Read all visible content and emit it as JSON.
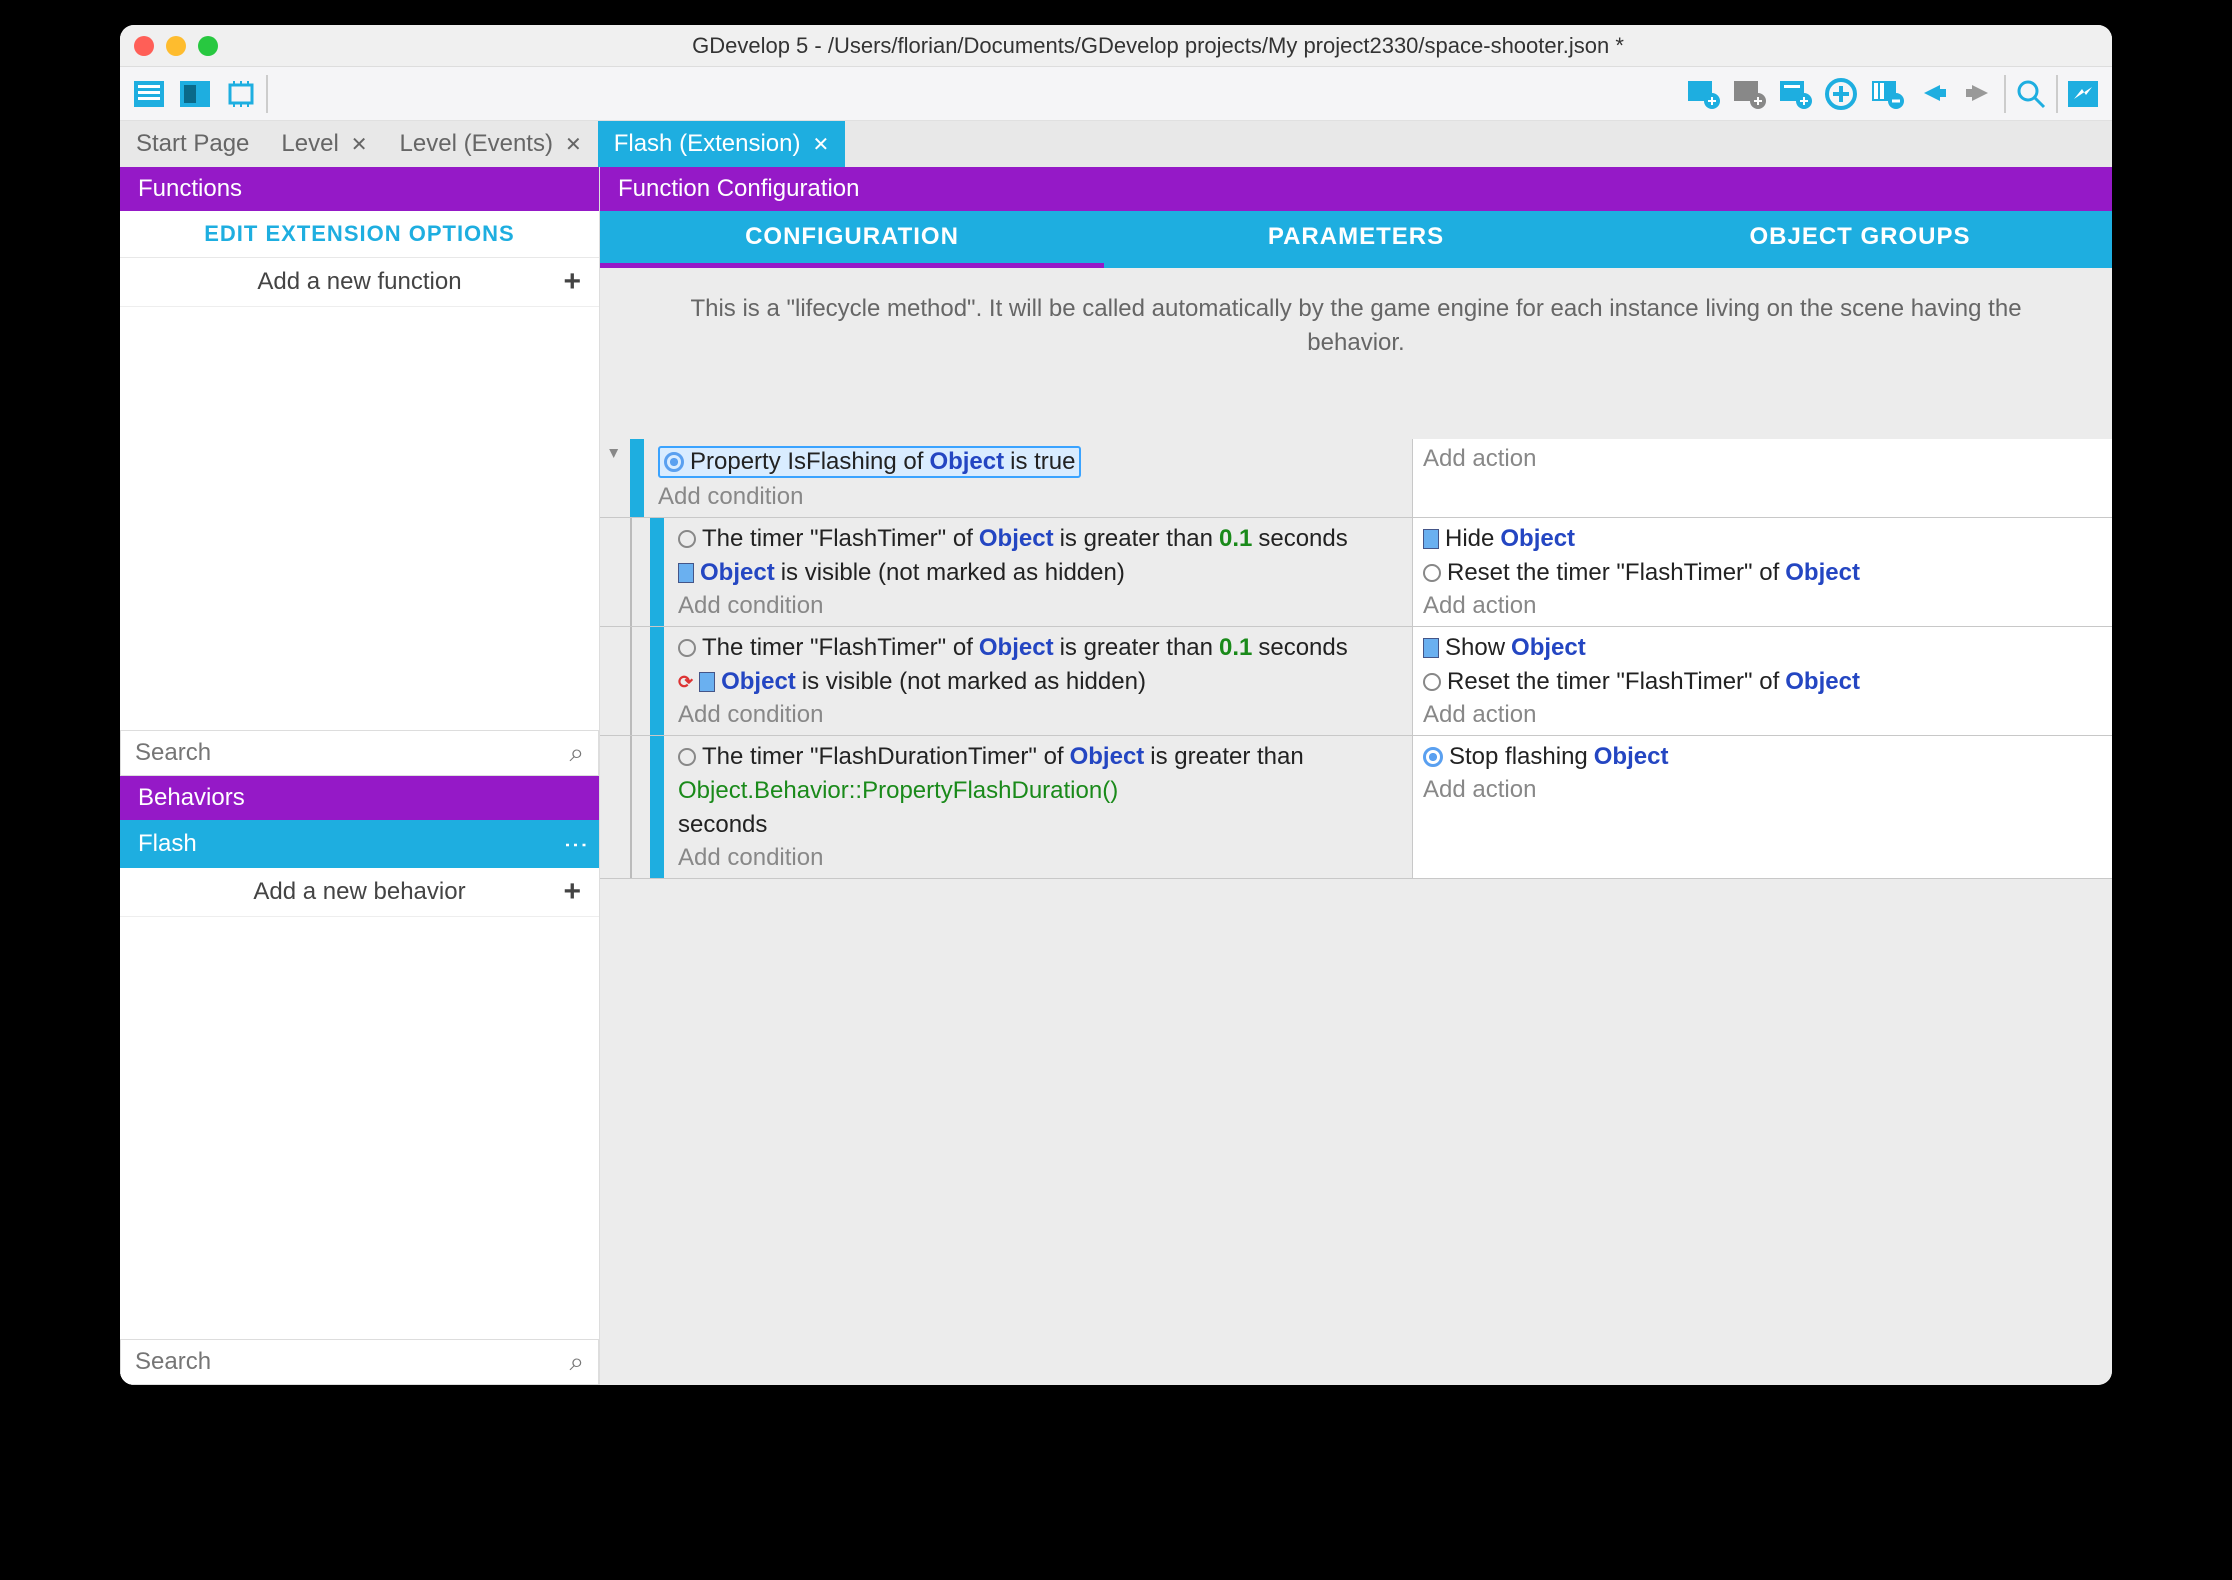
{
  "window_title": "GDevelop 5 - /Users/florian/Documents/GDevelop projects/My project2330/space-shooter.json *",
  "tabs": [
    {
      "label": "Start Page",
      "closable": false
    },
    {
      "label": "Level",
      "closable": true
    },
    {
      "label": "Level (Events)",
      "closable": true
    },
    {
      "label": "Flash (Extension)",
      "closable": true,
      "active": true
    }
  ],
  "sidebar": {
    "functions_hdr": "Functions",
    "ext_options": "EDIT EXTENSION OPTIONS",
    "add_function": "Add a new function",
    "search_placeholder": "Search",
    "behaviors_hdr": "Behaviors",
    "behavior_item": "Flash",
    "add_behavior": "Add a new behavior",
    "search2_placeholder": "Search"
  },
  "main": {
    "hdr": "Function Configuration",
    "subtabs": {
      "config": "CONFIGURATION",
      "params": "PARAMETERS",
      "groups": "OBJECT GROUPS"
    },
    "desc": "This is a \"lifecycle method\". It will be called automatically by the game engine for each instance living on the scene having the behavior."
  },
  "events": {
    "row1": {
      "c1_a": "Property IsFlashing of ",
      "c1_obj": "Object",
      "c1_b": " is true",
      "addc": "Add condition",
      "adda": "Add action"
    },
    "row2": {
      "c1_a": "The timer \"FlashTimer\" of ",
      "c1_obj": "Object",
      "c1_b": " is greater than ",
      "c1_num": "0.1",
      "c1_c": " seconds",
      "c2_obj": "Object",
      "c2_b": " is visible (not marked as hidden)",
      "addc": "Add condition",
      "a1_a": "Hide ",
      "a1_obj": "Object",
      "a2_a": "Reset the timer \"FlashTimer\" of ",
      "a2_obj": "Object",
      "adda": "Add action"
    },
    "row3": {
      "c1_a": "The timer \"FlashTimer\" of ",
      "c1_obj": "Object",
      "c1_b": " is greater than ",
      "c1_num": "0.1",
      "c1_c": " seconds",
      "c2_obj": "Object",
      "c2_b": " is visible (not marked as hidden)",
      "addc": "Add condition",
      "a1_a": "Show ",
      "a1_obj": "Object",
      "a2_a": "Reset the timer \"FlashTimer\" of ",
      "a2_obj": "Object",
      "adda": "Add action"
    },
    "row4": {
      "c1_a": "The timer \"FlashDurationTimer\" of ",
      "c1_obj": "Object",
      "c1_b": " is greater than ",
      "c1_expr": "Object.Behavior::PropertyFlashDuration()",
      "c1_c": " seconds",
      "addc": "Add condition",
      "a1_a": "Stop flashing ",
      "a1_obj": "Object",
      "adda": "Add action"
    }
  }
}
